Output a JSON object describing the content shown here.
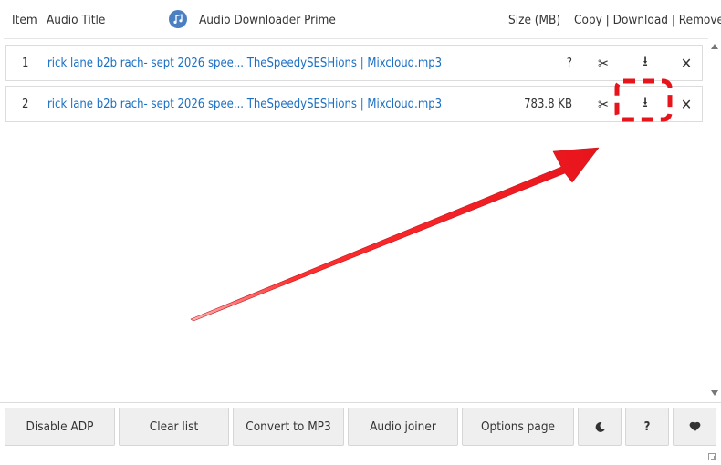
{
  "header": {
    "item_label": "Item",
    "title_label": "Audio Title",
    "brand": "Audio Downloader Prime",
    "size_label": "Size (MB)",
    "actions_label": "Copy | Download | Remove"
  },
  "rows": [
    {
      "num": "1",
      "title": "rick lane b2b rach- sept 2026 spee... TheSpeedySESHions | Mixcloud.mp3",
      "size": "?"
    },
    {
      "num": "2",
      "title": "rick lane b2b rach- sept 2026 spee... TheSpeedySESHions | Mixcloud.mp3",
      "size": "783.8 KB"
    }
  ],
  "icons": {
    "cut": "✂",
    "download": "⭳",
    "remove": "✕"
  },
  "toolbar": {
    "disable_adp": "Disable ADP",
    "clear_list": "Clear list",
    "convert_mp3": "Convert to MP3",
    "audio_joiner": "Audio joiner",
    "options_page": "Options page",
    "help": "?"
  },
  "colors": {
    "link": "#1a6fc4",
    "brand_icon": "#4a7fc1",
    "annotation": "#e8141c"
  }
}
